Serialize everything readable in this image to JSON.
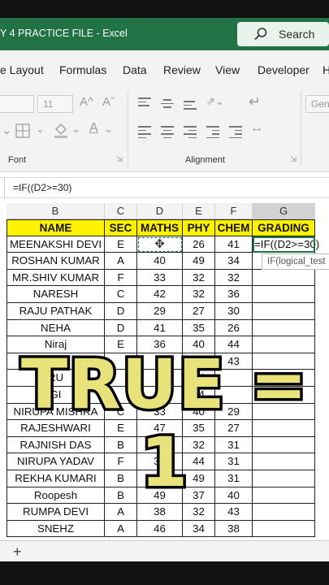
{
  "title_bar": {
    "file_title": "Y 4 PRACTICE FILE  -  Excel",
    "search_label": "Search"
  },
  "menu": [
    "e Layout",
    "Formulas",
    "Data",
    "Review",
    "View",
    "Developer",
    "H"
  ],
  "ribbon": {
    "font_size": "11",
    "grow_font": "A^",
    "shrink_font": "Aˇ",
    "font_group": "Font",
    "alignment_group": "Alignment",
    "general_combo": "Gene"
  },
  "formula_bar": {
    "content": "=IF((D2>=30)"
  },
  "columns": [
    "B",
    "C",
    "D",
    "E",
    "F",
    "G"
  ],
  "headers": [
    "NAME",
    "SEC",
    "MATHS",
    "PHY",
    "CHEM",
    "GRADING"
  ],
  "rows": [
    [
      "MEENAKSHI DEVI",
      "E",
      "",
      "26",
      "41",
      "=IF((D2>=30)"
    ],
    [
      "ROSHAN KUMAR",
      "A",
      "40",
      "49",
      "34",
      ""
    ],
    [
      "MR.SHIV KUMAR",
      "F",
      "33",
      "32",
      "32",
      ""
    ],
    [
      "NARESH",
      "C",
      "42",
      "32",
      "36",
      ""
    ],
    [
      "RAJU PATHAK",
      "D",
      "29",
      "27",
      "30",
      ""
    ],
    [
      "NEHA",
      "D",
      "41",
      "35",
      "26",
      ""
    ],
    [
      "Niraj",
      "E",
      "36",
      "40",
      "44",
      ""
    ],
    [
      "",
      "",
      "",
      "9",
      "43",
      ""
    ],
    [
      "RU",
      "",
      "",
      "44",
      "",
      ""
    ],
    [
      "GI",
      "",
      "",
      "44",
      "",
      ""
    ],
    [
      "NIRUPA MISHRA",
      "C",
      "33",
      "40",
      "29",
      ""
    ],
    [
      "RAJESHWARI",
      "E",
      "47",
      "35",
      "27",
      ""
    ],
    [
      "RAJNISH DAS",
      "B",
      "38",
      "32",
      "31",
      ""
    ],
    [
      "NIRUPA YADAV",
      "F",
      "38",
      "44",
      "31",
      ""
    ],
    [
      "REKHA KUMARI",
      "B",
      "41",
      "49",
      "31",
      ""
    ],
    [
      "Roopesh",
      "B",
      "49",
      "37",
      "40",
      ""
    ],
    [
      "RUMPA DEVI",
      "A",
      "38",
      "32",
      "43",
      ""
    ],
    [
      "SNEHZ",
      "A",
      "46",
      "34",
      "38",
      ""
    ]
  ],
  "tooltip": "IF(logical_test",
  "overlay_text": "TRUE = 1",
  "colors": {
    "excel_green": "#217346",
    "header_yellow": "#fff200",
    "overlay_yellow": "#e8e27a"
  }
}
